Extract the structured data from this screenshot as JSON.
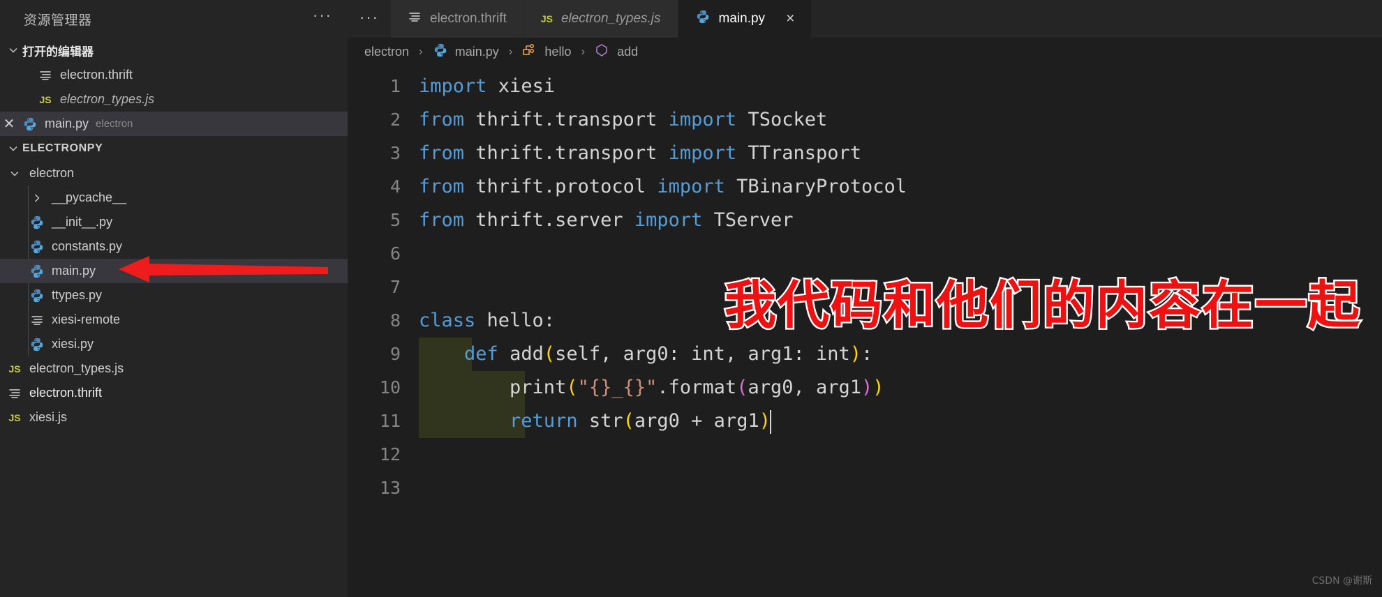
{
  "sidebar": {
    "title": "资源管理器",
    "more_label": "···",
    "open_editors": {
      "label": "打开的编辑器",
      "items": [
        {
          "name": "electron.thrift",
          "icon": "thrift-file-icon",
          "italic": false,
          "selected": false,
          "has_close": false,
          "sub": ""
        },
        {
          "name": "electron_types.js",
          "icon": "js-file-icon",
          "italic": true,
          "selected": false,
          "has_close": false,
          "sub": ""
        },
        {
          "name": "main.py",
          "icon": "python-file-icon",
          "italic": false,
          "selected": true,
          "has_close": true,
          "sub": "electron"
        }
      ]
    },
    "project": {
      "label": "ELECTRONPY",
      "items": [
        {
          "name": "electron",
          "icon": "folder-open-icon",
          "kind": "folder",
          "depth": 1,
          "expanded": true,
          "selected": false
        },
        {
          "name": "__pycache__",
          "icon": "folder-collapsed-icon",
          "kind": "folder",
          "depth": 2,
          "expanded": false,
          "selected": false
        },
        {
          "name": "__init__.py",
          "icon": "python-file-icon",
          "kind": "file",
          "depth": 2,
          "selected": false
        },
        {
          "name": "constants.py",
          "icon": "python-file-icon",
          "kind": "file",
          "depth": 2,
          "selected": false
        },
        {
          "name": "main.py",
          "icon": "python-file-icon",
          "kind": "file",
          "depth": 2,
          "selected": true
        },
        {
          "name": "ttypes.py",
          "icon": "python-file-icon",
          "kind": "file",
          "depth": 2,
          "selected": false
        },
        {
          "name": "xiesi-remote",
          "icon": "thrift-file-icon",
          "kind": "file",
          "depth": 2,
          "selected": false
        },
        {
          "name": "xiesi.py",
          "icon": "python-file-icon",
          "kind": "file",
          "depth": 2,
          "selected": false
        },
        {
          "name": "electron_types.js",
          "icon": "js-file-icon",
          "kind": "file",
          "depth": 1,
          "selected": false
        },
        {
          "name": "electron.thrift",
          "icon": "thrift-file-icon",
          "kind": "file",
          "depth": 1,
          "selected": false,
          "bright": true
        },
        {
          "name": "xiesi.js",
          "icon": "js-file-icon",
          "kind": "file",
          "depth": 1,
          "selected": false
        }
      ]
    }
  },
  "tabs": {
    "more_label": "···",
    "items": [
      {
        "label": "electron.thrift",
        "icon": "thrift-file-icon",
        "italic": false,
        "active": false,
        "closable": false
      },
      {
        "label": "electron_types.js",
        "icon": "js-file-icon",
        "italic": true,
        "active": false,
        "closable": false
      },
      {
        "label": "main.py",
        "icon": "python-file-icon",
        "italic": false,
        "active": true,
        "closable": true,
        "close_label": "×"
      }
    ]
  },
  "breadcrumb": [
    {
      "label": "electron",
      "icon": ""
    },
    {
      "label": "main.py",
      "icon": "python-file-icon"
    },
    {
      "label": "hello",
      "icon": "class-symbol-icon"
    },
    {
      "label": "add",
      "icon": "method-symbol-icon"
    }
  ],
  "code": {
    "lines": [
      {
        "num": "1",
        "tokens": [
          {
            "t": "import",
            "c": "k"
          },
          {
            "t": " xiesi",
            "c": "pl"
          }
        ]
      },
      {
        "num": "2",
        "tokens": [
          {
            "t": "from",
            "c": "k"
          },
          {
            "t": " thrift.transport ",
            "c": "pl"
          },
          {
            "t": "import",
            "c": "k"
          },
          {
            "t": " TSocket",
            "c": "pl"
          }
        ]
      },
      {
        "num": "3",
        "tokens": [
          {
            "t": "from",
            "c": "k"
          },
          {
            "t": " thrift.transport ",
            "c": "pl"
          },
          {
            "t": "import",
            "c": "k"
          },
          {
            "t": " TTransport",
            "c": "pl"
          }
        ]
      },
      {
        "num": "4",
        "tokens": [
          {
            "t": "from",
            "c": "k"
          },
          {
            "t": " thrift.protocol ",
            "c": "pl"
          },
          {
            "t": "import",
            "c": "k"
          },
          {
            "t": " TBinaryProtocol",
            "c": "pl"
          }
        ]
      },
      {
        "num": "5",
        "tokens": [
          {
            "t": "from",
            "c": "k"
          },
          {
            "t": " thrift.server ",
            "c": "pl"
          },
          {
            "t": "import",
            "c": "k"
          },
          {
            "t": " TServer",
            "c": "pl"
          }
        ]
      },
      {
        "num": "6",
        "tokens": []
      },
      {
        "num": "7",
        "tokens": []
      },
      {
        "num": "8",
        "tokens": [
          {
            "t": "class",
            "c": "k"
          },
          {
            "t": " hello:",
            "c": "pl"
          }
        ]
      },
      {
        "num": "9",
        "tokens": [
          {
            "t": "    ",
            "c": "pl"
          },
          {
            "t": "def",
            "c": "k"
          },
          {
            "t": " add",
            "c": "pl"
          },
          {
            "t": "(",
            "c": "par1"
          },
          {
            "t": "self, arg0: int, arg1: int",
            "c": "pl"
          },
          {
            "t": ")",
            "c": "par1"
          },
          {
            "t": ":",
            "c": "pl"
          }
        ]
      },
      {
        "num": "10",
        "tokens": [
          {
            "t": "        print",
            "c": "pl"
          },
          {
            "t": "(",
            "c": "par1"
          },
          {
            "t": "\"{}_{}\"",
            "c": "str"
          },
          {
            "t": ".format",
            "c": "pl"
          },
          {
            "t": "(",
            "c": "par2"
          },
          {
            "t": "arg0, arg1",
            "c": "pl"
          },
          {
            "t": ")",
            "c": "par2"
          },
          {
            "t": ")",
            "c": "par1"
          }
        ]
      },
      {
        "num": "11",
        "tokens": [
          {
            "t": "        ",
            "c": "pl"
          },
          {
            "t": "return",
            "c": "k"
          },
          {
            "t": " str",
            "c": "pl"
          },
          {
            "t": "(",
            "c": "par1"
          },
          {
            "t": "arg0 + arg1",
            "c": "pl"
          },
          {
            "t": ")",
            "c": "par1"
          }
        ],
        "cursor": true
      },
      {
        "num": "12",
        "tokens": []
      },
      {
        "num": "13",
        "tokens": []
      }
    ]
  },
  "annotations": {
    "overlay_text": "我代码和他们的内容在一起",
    "overlay_color": "#ee1111",
    "arrow_color": "#ee1c1c",
    "watermark": "CSDN @谢斯"
  }
}
